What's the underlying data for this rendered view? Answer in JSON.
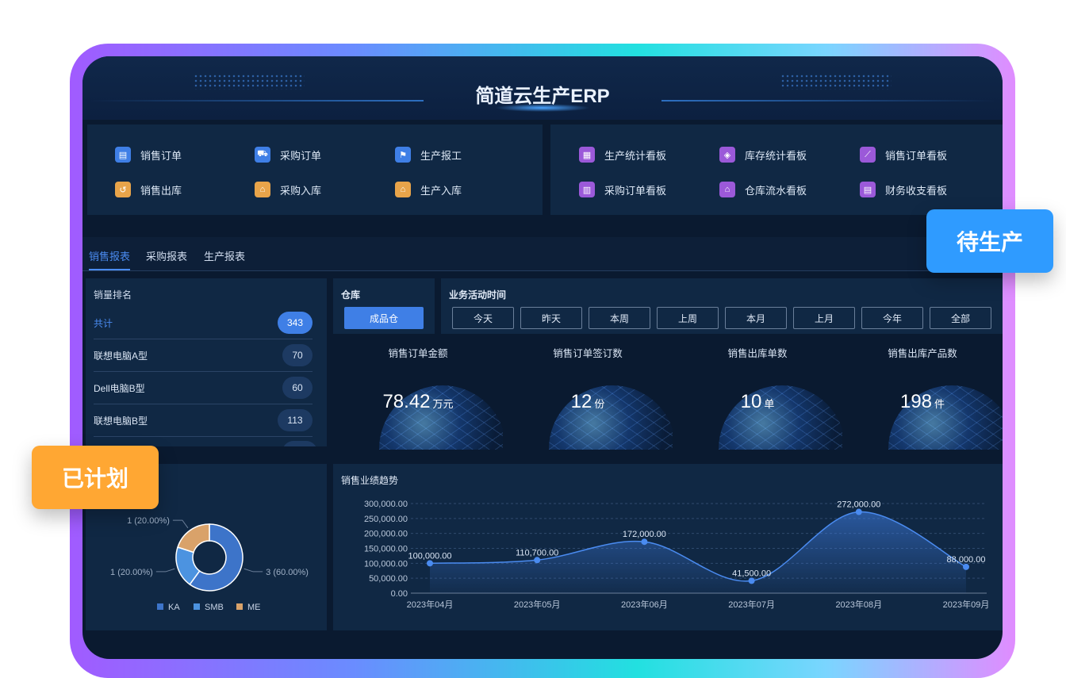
{
  "header": {
    "title": "简道云生产ERP"
  },
  "nav_left": [
    {
      "label": "销售订单",
      "icon": "doc-icon",
      "color": "#3f7fe6"
    },
    {
      "label": "采购订单",
      "icon": "cart-icon",
      "color": "#3f7fe6"
    },
    {
      "label": "生产报工",
      "icon": "flag-icon",
      "color": "#3f7fe6"
    },
    {
      "label": "销售出库",
      "icon": "outbox-icon",
      "color": "#e8a44a"
    },
    {
      "label": "采购入库",
      "icon": "inbox-icon",
      "color": "#e8a44a"
    },
    {
      "label": "生产入库",
      "icon": "factory-icon",
      "color": "#e8a44a"
    }
  ],
  "nav_right": [
    {
      "label": "生产统计看板",
      "icon": "dashboard-icon"
    },
    {
      "label": "库存统计看板",
      "icon": "box-icon"
    },
    {
      "label": "销售订单看板",
      "icon": "line-chart-icon"
    },
    {
      "label": "采购订单看板",
      "icon": "bar-chart-icon"
    },
    {
      "label": "仓库流水看板",
      "icon": "warehouse-icon"
    },
    {
      "label": "财务收支看板",
      "icon": "money-icon"
    }
  ],
  "tabs": [
    "销售报表",
    "采购报表",
    "生产报表"
  ],
  "ranking": {
    "title": "销量排名",
    "rows": [
      {
        "name": "共计",
        "value": "343"
      },
      {
        "name": "联想电脑A型",
        "value": "70"
      },
      {
        "name": "Dell电脑B型",
        "value": "60"
      },
      {
        "name": "联想电脑B型",
        "value": "113"
      }
    ]
  },
  "filters": {
    "warehouse_label": "仓库",
    "warehouse_value": "成品仓",
    "time_label": "业务活动时间",
    "time_options": [
      "今天",
      "昨天",
      "本周",
      "上周",
      "本月",
      "上月",
      "今年",
      "全部"
    ]
  },
  "kpis": [
    {
      "label": "销售订单金额",
      "value": "78.42",
      "unit": "万元"
    },
    {
      "label": "销售订单签订数",
      "value": "12",
      "unit": "份"
    },
    {
      "label": "销售出库单数",
      "value": "10",
      "unit": "单"
    },
    {
      "label": "销售出库产品数",
      "value": "198",
      "unit": "件"
    }
  ],
  "badges": {
    "left": "已计划",
    "right": "待生产"
  },
  "colors": {
    "accent": "#3f7fe6",
    "orange": "#ffa733",
    "blue_badge": "#2f9bff",
    "panel": "#102844"
  },
  "chart_data": [
    {
      "type": "pie",
      "title": "",
      "slices": [
        {
          "label": "KA",
          "value": 3,
          "text": "3 (60.00%)",
          "color": "#3d74c9"
        },
        {
          "label": "SMB",
          "value": 1,
          "text": "1 (20.00%)",
          "color": "#4c93e0"
        },
        {
          "label": "ME",
          "value": 1,
          "text": "1 (20.00%)",
          "color": "#d9a26a"
        }
      ],
      "legend": [
        "KA",
        "SMB",
        "ME"
      ]
    },
    {
      "type": "area",
      "title": "销售业绩趋势",
      "categories": [
        "2023年04月",
        "2023年05月",
        "2023年06月",
        "2023年07月",
        "2023年08月",
        "2023年09月"
      ],
      "values": [
        100000,
        110700,
        172000,
        41500,
        272000,
        88000
      ],
      "value_labels": [
        "100,000.00",
        "110,700.00",
        "172,000.00",
        "41,500.00",
        "272,000.00",
        "88,000.00"
      ],
      "y_ticks": [
        "300,000.00",
        "250,000.00",
        "200,000.00",
        "150,000.00",
        "100,000.00",
        "50,000.00",
        "0.00"
      ],
      "ylim": [
        0,
        300000
      ]
    }
  ]
}
